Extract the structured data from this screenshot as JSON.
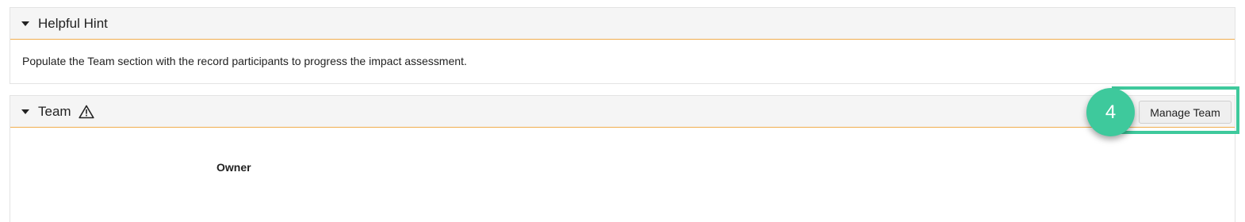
{
  "hint_panel": {
    "title": "Helpful Hint",
    "body": "Populate the Team section with the record participants to progress the impact assessment."
  },
  "team_panel": {
    "title": "Team",
    "warning_icon": "warning-triangle-icon",
    "owner_label": "Owner",
    "manage_button_label": "Manage Team"
  },
  "tutorial": {
    "step_number": "4"
  },
  "colors": {
    "accent_line": "#f0ad4e",
    "highlight": "#3ec99c",
    "header_bg": "#f5f5f5"
  }
}
